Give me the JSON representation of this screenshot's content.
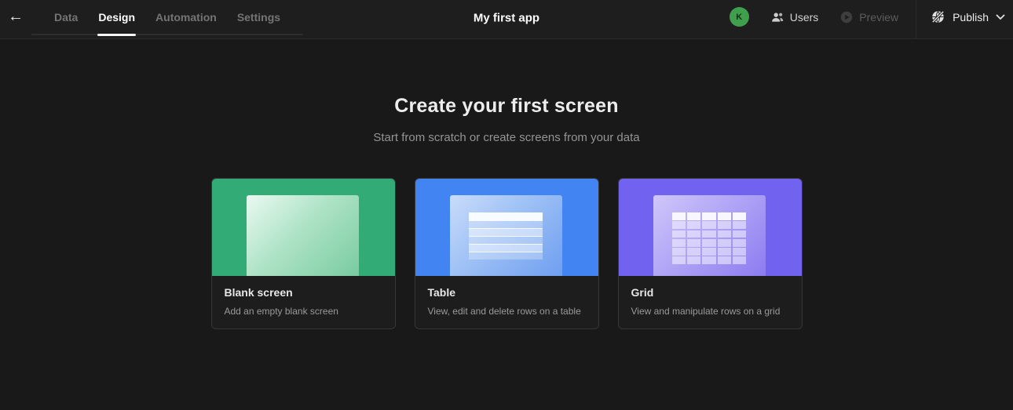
{
  "topbar": {
    "back_icon": "←",
    "tabs": [
      {
        "label": "Data",
        "active": false
      },
      {
        "label": "Design",
        "active": true
      },
      {
        "label": "Automation",
        "active": false
      },
      {
        "label": "Settings",
        "active": false
      }
    ],
    "app_title": "My first app",
    "avatar": {
      "initial": "K",
      "color": "#3f9f4c"
    },
    "users": {
      "label": "Users"
    },
    "preview": {
      "label": "Preview",
      "enabled": false
    },
    "publish": {
      "label": "Publish"
    }
  },
  "main": {
    "heading": "Create your first screen",
    "subheading": "Start from scratch or create screens from your data",
    "cards": [
      {
        "title": "Blank screen",
        "subtitle": "Add an empty blank screen",
        "accent": "#32ab76"
      },
      {
        "title": "Table",
        "subtitle": "View, edit and delete rows on a table",
        "accent": "#4285f2"
      },
      {
        "title": "Grid",
        "subtitle": "View and manipulate rows on a grid",
        "accent": "#7162f0"
      }
    ]
  },
  "colors": {
    "topbar_bg": "#1e1e1e",
    "page_bg": "#191919",
    "border": "#2b2b2b",
    "active_tab_underline": "#f5f5f5"
  }
}
